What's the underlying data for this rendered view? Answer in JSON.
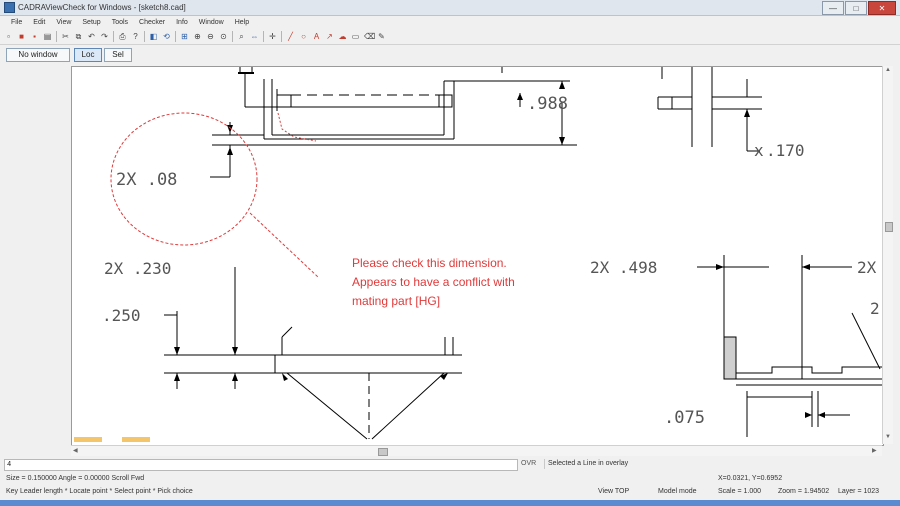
{
  "window": {
    "title": "CADRAViewCheck for Windows - [sketch8.cad]",
    "minimize": "—",
    "maximize": "□",
    "close": "✕"
  },
  "menu": [
    "File",
    "Edit",
    "View",
    "Setup",
    "Tools",
    "Checker",
    "Info",
    "Window",
    "Help"
  ],
  "modebar": {
    "no_window": "No window",
    "loc": "Loc",
    "sel": "Sel"
  },
  "drawing": {
    "note_lines": [
      "Please check this dimension.",
      "Appears to have a conflict with",
      "mating part [HG]"
    ],
    "dims": {
      "d_988": ".988",
      "d_170": ".170",
      "d_2x08": "2X  .08",
      "d_2x230": "2X  .230",
      "d_250": ".250",
      "d_2x498": "2X  .498",
      "d_2x_right": "2X",
      "d_2_right": "2",
      "d_075": ".075",
      "d_x_right": "x"
    },
    "markup_color": "#e03a3a"
  },
  "command": {
    "input_value": "4",
    "ovr_label": "OVR",
    "message": "Selected a Line in overlay"
  },
  "status": {
    "size_angle": "Size = 0.150000  Angle = 0.00000  Scroll Fwd",
    "coords": "X=0.0321, Y=0.6952",
    "hint": "Key Leader length * Locate point * Select point * Pick choice",
    "view": "View TOP",
    "mode": "Model mode",
    "scale": "Scale = 1.000",
    "zoom": "Zoom = 1.94502",
    "layer": "Layer = 1023"
  }
}
